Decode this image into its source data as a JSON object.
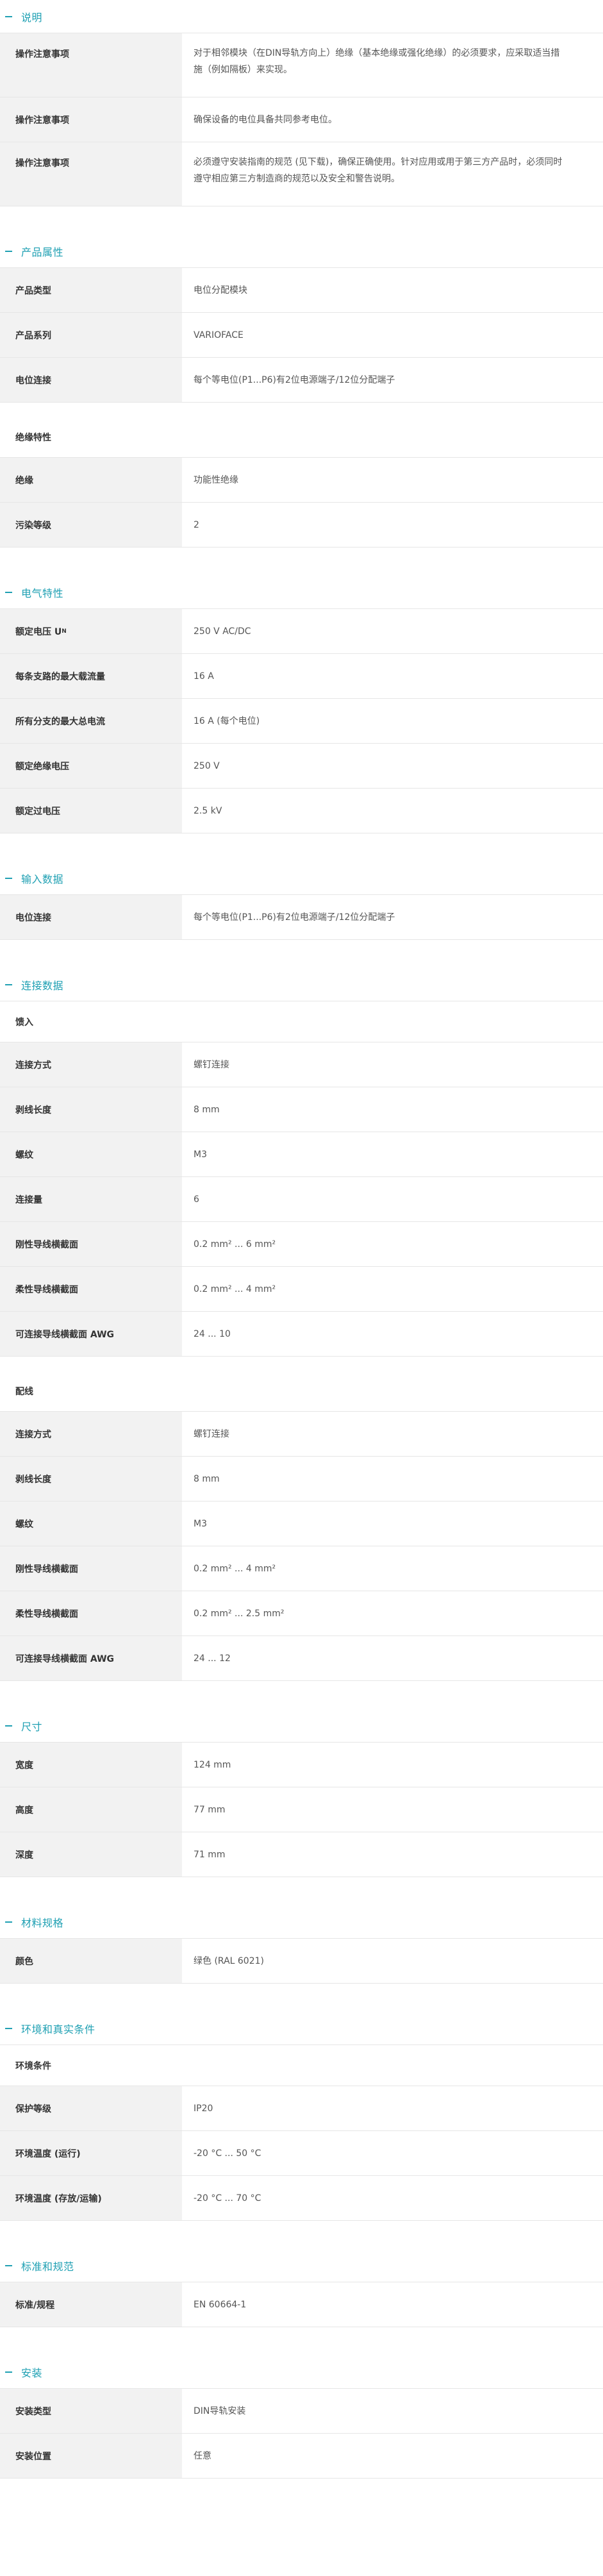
{
  "sections": {
    "s1": {
      "title": "说明",
      "rows": [
        {
          "k": "操作注意事项",
          "v": "对于相邻模块（在DIN导轨方向上）绝缘（基本绝缘或强化绝缘）的必须要求，应采取适当措施（例如隔板）来实现。"
        },
        {
          "k": "操作注意事项",
          "v": "确保设备的电位具备共同参考电位。"
        },
        {
          "k": "操作注意事项",
          "v": "必须遵守安装指南的规范 (见下载)，确保正确使用。针对应用或用于第三方产品时，必须同时遵守相应第三方制造商的规范以及安全和警告说明。"
        }
      ]
    },
    "s2": {
      "title": "产品属性",
      "rows": [
        {
          "k": "产品类型",
          "v": "电位分配模块"
        },
        {
          "k": "产品系列",
          "v": "VARIOFACE"
        },
        {
          "k": "电位连接",
          "v": "每个等电位(P1...P6)有2位电源端子/12位分配端子"
        }
      ],
      "sub_title": "绝缘特性",
      "sub_rows": [
        {
          "k": "绝缘",
          "v": "功能性绝缘"
        },
        {
          "k": "污染等级",
          "v": "2"
        }
      ]
    },
    "s3": {
      "title": "电气特性",
      "rows": [
        {
          "k": "额定电压 U",
          "k_sub": "N",
          "v": "250 V AC/DC"
        },
        {
          "k": "每条支路的最大载流量",
          "v": "16 A"
        },
        {
          "k": "所有分支的最大总电流",
          "v": "16 A (每个电位)"
        },
        {
          "k": "额定绝缘电压",
          "v": "250 V"
        },
        {
          "k": "额定过电压",
          "v": "2.5 kV"
        }
      ]
    },
    "s4": {
      "title": "输入数据",
      "rows": [
        {
          "k": "电位连接",
          "v": "每个等电位(P1...P6)有2位电源端子/12位分配端子"
        }
      ]
    },
    "s5": {
      "title": "连接数据",
      "sub1_title": "馈入",
      "sub1_rows": [
        {
          "k": "连接方式",
          "v": "螺钉连接"
        },
        {
          "k": "剥线长度",
          "v": "8 mm"
        },
        {
          "k": "螺纹",
          "v": "M3"
        },
        {
          "k": "连接量",
          "v": "6"
        },
        {
          "k": "刚性导线横截面",
          "v": "0.2 mm² ... 6 mm²"
        },
        {
          "k": "柔性导线横截面",
          "v": "0.2 mm² ... 4 mm²"
        },
        {
          "k": "可连接导线横截面 AWG",
          "v": "24 ... 10"
        }
      ],
      "sub2_title": "配线",
      "sub2_rows": [
        {
          "k": "连接方式",
          "v": "螺钉连接"
        },
        {
          "k": "剥线长度",
          "v": "8 mm"
        },
        {
          "k": "螺纹",
          "v": "M3"
        },
        {
          "k": "刚性导线横截面",
          "v": "0.2 mm² ... 4 mm²"
        },
        {
          "k": "柔性导线横截面",
          "v": "0.2 mm² ... 2.5 mm²"
        },
        {
          "k": "可连接导线横截面 AWG",
          "v": "24 ... 12"
        }
      ]
    },
    "s6": {
      "title": "尺寸",
      "rows": [
        {
          "k": "宽度",
          "v": "124 mm"
        },
        {
          "k": "高度",
          "v": "77 mm"
        },
        {
          "k": "深度",
          "v": "71 mm"
        }
      ]
    },
    "s7": {
      "title": "材料规格",
      "rows": [
        {
          "k": "颜色",
          "v": "绿色 (RAL 6021)"
        }
      ]
    },
    "s8": {
      "title": "环境和真实条件",
      "sub_title": "环境条件",
      "rows": [
        {
          "k": "保护等级",
          "v": "IP20"
        },
        {
          "k": "环境温度 (运行)",
          "v": "-20 °C ... 50 °C"
        },
        {
          "k": "环境温度 (存放/运输)",
          "v": "-20 °C ... 70 °C"
        }
      ]
    },
    "s9": {
      "title": "标准和规范",
      "rows": [
        {
          "k": "标准/规程",
          "v": "EN 60664-1"
        }
      ]
    },
    "s10": {
      "title": "安装",
      "rows": [
        {
          "k": "安装类型",
          "v": "DIN导轨安装"
        },
        {
          "k": "安装位置",
          "v": "任意"
        }
      ]
    }
  },
  "colors": {
    "accent": "#1fa0b3",
    "label_bg": "#f2f2f2",
    "divider": "#e6e6e6"
  }
}
